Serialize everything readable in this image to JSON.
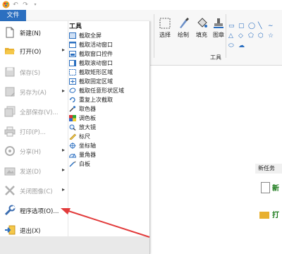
{
  "quick_access": {
    "app_icon": "paint-app-icon",
    "undo_icon": "undo-icon",
    "redo_icon": "redo-icon",
    "customize_icon": "customize-arrow-icon"
  },
  "file_tab": {
    "label": "文件"
  },
  "ribbon": {
    "buttons": [
      {
        "label": "选择",
        "icon": "select-icon"
      },
      {
        "label": "绘制",
        "icon": "brush-icon"
      },
      {
        "label": "填充",
        "icon": "fill-bucket-icon"
      },
      {
        "label": "图章",
        "icon": "stamp-icon"
      }
    ],
    "group_label": "工具"
  },
  "file_menu": {
    "items": [
      {
        "label": "新建(N)",
        "icon": "new-doc-icon",
        "disabled": false,
        "submenu": false
      },
      {
        "label": "打开(O)",
        "icon": "open-folder-icon",
        "disabled": false,
        "submenu": true
      },
      {
        "label": "保存(S)",
        "icon": "save-icon",
        "disabled": true,
        "submenu": false
      },
      {
        "label": "另存为(A)",
        "icon": "save-as-icon",
        "disabled": true,
        "submenu": true
      },
      {
        "label": "全部保存(V)...",
        "icon": "save-all-icon",
        "disabled": true,
        "submenu": false
      },
      {
        "label": "打印(P)...",
        "icon": "print-icon",
        "disabled": true,
        "submenu": false
      },
      {
        "label": "分享(H)",
        "icon": "share-icon",
        "disabled": true,
        "submenu": true
      },
      {
        "label": "发送(D)",
        "icon": "send-icon",
        "disabled": true,
        "submenu": true
      },
      {
        "label": "关闭图像(C)",
        "icon": "close-image-icon",
        "disabled": true,
        "submenu": true
      },
      {
        "label": "程序选项(O)...",
        "icon": "wrench-icon",
        "disabled": false,
        "submenu": false
      },
      {
        "label": "退出(X)",
        "icon": "exit-icon",
        "disabled": false,
        "submenu": false
      }
    ]
  },
  "tools_panel": {
    "title": "工具",
    "items": [
      {
        "label": "截取全屏",
        "icon": "fullscreen-capture-icon"
      },
      {
        "label": "截取活动窗口",
        "icon": "active-window-capture-icon"
      },
      {
        "label": "截取窗口控件",
        "icon": "window-control-capture-icon"
      },
      {
        "label": "截取滚动窗口",
        "icon": "scrolling-window-capture-icon"
      },
      {
        "label": "截取矩形区域",
        "icon": "rectangle-capture-icon"
      },
      {
        "label": "截取固定区域",
        "icon": "fixed-region-capture-icon"
      },
      {
        "label": "截取任意形状区域",
        "icon": "freehand-capture-icon"
      },
      {
        "label": "重复上次截取",
        "icon": "repeat-capture-icon"
      },
      {
        "label": "取色器",
        "icon": "color-picker-icon"
      },
      {
        "label": "调色板",
        "icon": "palette-icon"
      },
      {
        "label": "放大镜",
        "icon": "magnifier-icon"
      },
      {
        "label": "标尺",
        "icon": "ruler-icon"
      },
      {
        "label": "坐标轴",
        "icon": "crosshair-icon"
      },
      {
        "label": "量角器",
        "icon": "protractor-icon"
      },
      {
        "label": "白板",
        "icon": "whiteboard-icon"
      }
    ]
  },
  "task_pane": {
    "header": "新任务",
    "item1_text": "新",
    "item2_text": "打"
  },
  "colors": {
    "accent": "#2b6fc0",
    "annotation": "#e23b3b"
  }
}
